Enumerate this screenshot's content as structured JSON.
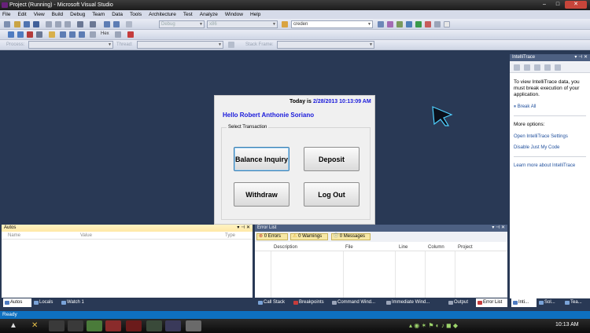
{
  "window": {
    "title": "Project (Running) - Microsoft Visual Studio",
    "controls": [
      "–",
      "□",
      "✕"
    ]
  },
  "menu": [
    "File",
    "Edit",
    "View",
    "Build",
    "Debug",
    "Team",
    "Data",
    "Tools",
    "Architecture",
    "Test",
    "Analyze",
    "Window",
    "Help"
  ],
  "toolbar": {
    "config": "Debug",
    "platform": "x86",
    "find": "creden",
    "hex_label": "Hex",
    "process_label": "Process:",
    "thread_label": "Thread:",
    "stack_frame_label": "Stack Frame:"
  },
  "app": {
    "today_label": "Today is",
    "today_value": "2/28/2013 10:13:09 AM",
    "hello": "Hello  Robert Anthonie Soriano",
    "group_label": "Select Transaction",
    "buttons": {
      "balance": "Balance Inquiry",
      "deposit": "Deposit",
      "withdraw": "Withdraw",
      "logout": "Log Out"
    }
  },
  "autos": {
    "title": "Autos",
    "columns": [
      "Name",
      "Value",
      "Type"
    ],
    "tabs": [
      "Autos",
      "Locals",
      "Watch 1"
    ]
  },
  "errors": {
    "title": "Error List",
    "errors_btn": "0 Errors",
    "warnings_btn": "0 Warnings",
    "messages_btn": "0 Messages",
    "columns": [
      "Description",
      "File",
      "Line",
      "Column",
      "Project"
    ],
    "tabs": [
      "Call Stack",
      "Breakpoints",
      "Command Wind...",
      "Immediate Wind...",
      "Output",
      "Error List"
    ]
  },
  "intellitrace": {
    "title": "IntelliTrace",
    "message": "To view IntelliTrace data, you must break execution of your application.",
    "break_all": "Break All",
    "more_options": "More options:",
    "open_settings": "Open IntelliTrace Settings",
    "disable_jmc": "Disable Just My Code",
    "learn_more": "Learn more about IntelliTrace",
    "tabs": [
      "Inti...",
      "Sol...",
      "Tea..."
    ]
  },
  "status": "Ready",
  "clock": "10:13 AM",
  "colors": {
    "accent": "#1a1adb",
    "status_bar": "#0e70c0",
    "workspace": "#293955"
  }
}
